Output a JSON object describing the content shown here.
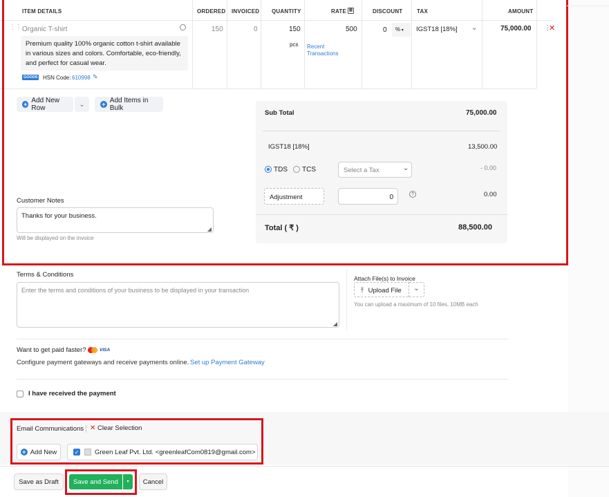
{
  "table": {
    "headers": {
      "item_details": "ITEM DETAILS",
      "ordered": "ORDERED",
      "invoiced": "INVOICED",
      "quantity": "QUANTITY",
      "rate": "RATE",
      "discount": "DISCOUNT",
      "tax": "TAX",
      "amount": "AMOUNT"
    },
    "row": {
      "item_name": "Organic T-shirt",
      "description_line1": "Premium quality 100% organic cotton t-shirt available",
      "description_line2": "in various sizes and colors. Comfortable, eco-friendly,",
      "description_line3": "and perfect for casual wear.",
      "badge": "GOODS",
      "hsn_label": "HSN Code:",
      "hsn_code": "610998",
      "ordered": "150",
      "invoiced": "0",
      "quantity": "150",
      "unit": "pcs",
      "rate": "500",
      "recent_line1": "Recent",
      "recent_line2": "Transactions",
      "discount": "0",
      "discount_type": "%",
      "tax": "IGST18 [18%]",
      "amount": "75,000.00"
    }
  },
  "actions": {
    "add_new_row": "Add New Row",
    "add_items_bulk": "Add Items in Bulk"
  },
  "summary": {
    "sub_total_label": "Sub Total",
    "sub_total_value": "75,000.00",
    "igst_label": "IGST18 [18%]",
    "igst_value": "13,500.00",
    "tds_label": "TDS",
    "tcs_label": "TCS",
    "select_tax_placeholder": "Select a Tax",
    "tds_value": "- 0.00",
    "adjustment_label": "Adjustment",
    "adjustment_value": "0",
    "adjustment_total": "0.00",
    "total_label": "Total ( ₹ )",
    "total_value": "88,500.00"
  },
  "customer_notes": {
    "label": "Customer Notes",
    "value": "Thanks for your business.",
    "hint": "Will be displayed on the invoice"
  },
  "terms": {
    "label": "Terms & Conditions",
    "placeholder": "Enter the terms and conditions of your business to be displayed in your transaction"
  },
  "attach": {
    "label": "Attach File(s) to Invoice",
    "upload_button": "Upload File",
    "hint": "You can upload a maximum of 10 files, 10MB each"
  },
  "payment": {
    "heading": "Want to get paid faster?",
    "visa": "VISA",
    "description": "Configure payment gateways and receive payments online.",
    "setup_link": "Set up Payment Gateway",
    "received_label": "I have received the payment"
  },
  "email": {
    "label": "Email Communications",
    "clear_selection": "Clear Selection",
    "add_new": "Add New",
    "contact": "Green Leaf Pvt. Ltd. <greenleafCom0819@gmail.com>"
  },
  "footer": {
    "save_draft": "Save as Draft",
    "save_send": "Save and Send",
    "cancel": "Cancel"
  },
  "colors": {
    "primary_green": "#21b05c",
    "link_blue": "#2e7bd8",
    "highlight_red": "#d9141b"
  }
}
